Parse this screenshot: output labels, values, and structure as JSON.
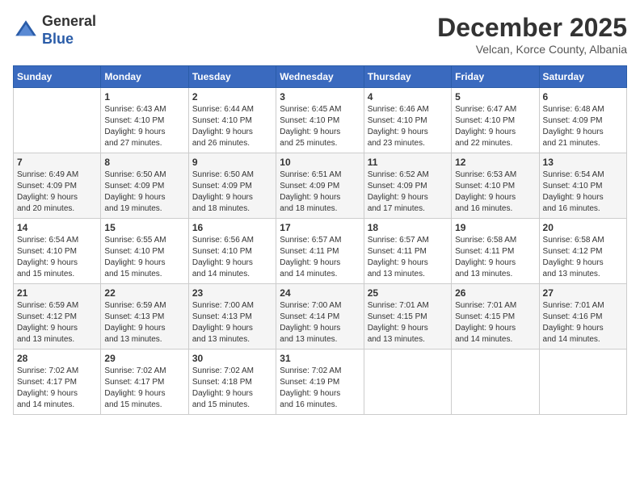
{
  "header": {
    "logo_line1": "General",
    "logo_line2": "Blue",
    "month_title": "December 2025",
    "subtitle": "Velcan, Korce County, Albania"
  },
  "days_of_week": [
    "Sunday",
    "Monday",
    "Tuesday",
    "Wednesday",
    "Thursday",
    "Friday",
    "Saturday"
  ],
  "weeks": [
    [
      {
        "day": "",
        "info": ""
      },
      {
        "day": "1",
        "info": "Sunrise: 6:43 AM\nSunset: 4:10 PM\nDaylight: 9 hours\nand 27 minutes."
      },
      {
        "day": "2",
        "info": "Sunrise: 6:44 AM\nSunset: 4:10 PM\nDaylight: 9 hours\nand 26 minutes."
      },
      {
        "day": "3",
        "info": "Sunrise: 6:45 AM\nSunset: 4:10 PM\nDaylight: 9 hours\nand 25 minutes."
      },
      {
        "day": "4",
        "info": "Sunrise: 6:46 AM\nSunset: 4:10 PM\nDaylight: 9 hours\nand 23 minutes."
      },
      {
        "day": "5",
        "info": "Sunrise: 6:47 AM\nSunset: 4:10 PM\nDaylight: 9 hours\nand 22 minutes."
      },
      {
        "day": "6",
        "info": "Sunrise: 6:48 AM\nSunset: 4:09 PM\nDaylight: 9 hours\nand 21 minutes."
      }
    ],
    [
      {
        "day": "7",
        "info": "Sunrise: 6:49 AM\nSunset: 4:09 PM\nDaylight: 9 hours\nand 20 minutes."
      },
      {
        "day": "8",
        "info": "Sunrise: 6:50 AM\nSunset: 4:09 PM\nDaylight: 9 hours\nand 19 minutes."
      },
      {
        "day": "9",
        "info": "Sunrise: 6:50 AM\nSunset: 4:09 PM\nDaylight: 9 hours\nand 18 minutes."
      },
      {
        "day": "10",
        "info": "Sunrise: 6:51 AM\nSunset: 4:09 PM\nDaylight: 9 hours\nand 18 minutes."
      },
      {
        "day": "11",
        "info": "Sunrise: 6:52 AM\nSunset: 4:09 PM\nDaylight: 9 hours\nand 17 minutes."
      },
      {
        "day": "12",
        "info": "Sunrise: 6:53 AM\nSunset: 4:10 PM\nDaylight: 9 hours\nand 16 minutes."
      },
      {
        "day": "13",
        "info": "Sunrise: 6:54 AM\nSunset: 4:10 PM\nDaylight: 9 hours\nand 16 minutes."
      }
    ],
    [
      {
        "day": "14",
        "info": "Sunrise: 6:54 AM\nSunset: 4:10 PM\nDaylight: 9 hours\nand 15 minutes."
      },
      {
        "day": "15",
        "info": "Sunrise: 6:55 AM\nSunset: 4:10 PM\nDaylight: 9 hours\nand 15 minutes."
      },
      {
        "day": "16",
        "info": "Sunrise: 6:56 AM\nSunset: 4:10 PM\nDaylight: 9 hours\nand 14 minutes."
      },
      {
        "day": "17",
        "info": "Sunrise: 6:57 AM\nSunset: 4:11 PM\nDaylight: 9 hours\nand 14 minutes."
      },
      {
        "day": "18",
        "info": "Sunrise: 6:57 AM\nSunset: 4:11 PM\nDaylight: 9 hours\nand 13 minutes."
      },
      {
        "day": "19",
        "info": "Sunrise: 6:58 AM\nSunset: 4:11 PM\nDaylight: 9 hours\nand 13 minutes."
      },
      {
        "day": "20",
        "info": "Sunrise: 6:58 AM\nSunset: 4:12 PM\nDaylight: 9 hours\nand 13 minutes."
      }
    ],
    [
      {
        "day": "21",
        "info": "Sunrise: 6:59 AM\nSunset: 4:12 PM\nDaylight: 9 hours\nand 13 minutes."
      },
      {
        "day": "22",
        "info": "Sunrise: 6:59 AM\nSunset: 4:13 PM\nDaylight: 9 hours\nand 13 minutes."
      },
      {
        "day": "23",
        "info": "Sunrise: 7:00 AM\nSunset: 4:13 PM\nDaylight: 9 hours\nand 13 minutes."
      },
      {
        "day": "24",
        "info": "Sunrise: 7:00 AM\nSunset: 4:14 PM\nDaylight: 9 hours\nand 13 minutes."
      },
      {
        "day": "25",
        "info": "Sunrise: 7:01 AM\nSunset: 4:15 PM\nDaylight: 9 hours\nand 13 minutes."
      },
      {
        "day": "26",
        "info": "Sunrise: 7:01 AM\nSunset: 4:15 PM\nDaylight: 9 hours\nand 14 minutes."
      },
      {
        "day": "27",
        "info": "Sunrise: 7:01 AM\nSunset: 4:16 PM\nDaylight: 9 hours\nand 14 minutes."
      }
    ],
    [
      {
        "day": "28",
        "info": "Sunrise: 7:02 AM\nSunset: 4:17 PM\nDaylight: 9 hours\nand 14 minutes."
      },
      {
        "day": "29",
        "info": "Sunrise: 7:02 AM\nSunset: 4:17 PM\nDaylight: 9 hours\nand 15 minutes."
      },
      {
        "day": "30",
        "info": "Sunrise: 7:02 AM\nSunset: 4:18 PM\nDaylight: 9 hours\nand 15 minutes."
      },
      {
        "day": "31",
        "info": "Sunrise: 7:02 AM\nSunset: 4:19 PM\nDaylight: 9 hours\nand 16 minutes."
      },
      {
        "day": "",
        "info": ""
      },
      {
        "day": "",
        "info": ""
      },
      {
        "day": "",
        "info": ""
      }
    ]
  ]
}
